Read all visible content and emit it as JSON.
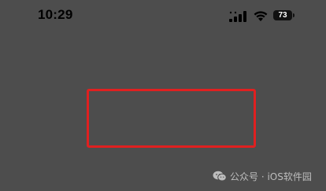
{
  "status_bar": {
    "time": "10:29",
    "battery_level": "73",
    "icons": [
      "cellular-signal-icon",
      "wifi-icon",
      "battery-icon"
    ]
  },
  "overlay": {
    "highlight_color": "#e02020"
  },
  "watermark": {
    "text": "公众号 · iOS软件园"
  },
  "colors": {
    "background": "#4d4d4d",
    "status_text": "#000000",
    "watermark_text": "#bdbdbd"
  }
}
